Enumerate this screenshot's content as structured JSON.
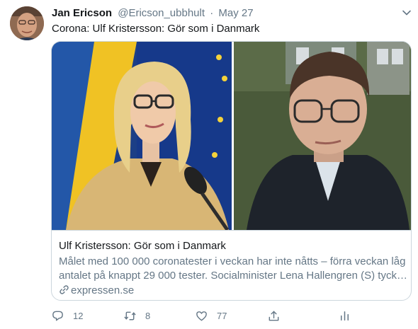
{
  "tweet": {
    "author_name": "Jan Ericson",
    "handle": "@Ericson_ubbhult",
    "separator": "·",
    "date": "May 27",
    "text": "Corona: Ulf Kristersson: Gör som i Danmark"
  },
  "card": {
    "title": "Ulf Kristersson: Gör som i Danmark",
    "description_line1": "Målet med 100 000 coronatester i veckan har inte nåtts – förra veckan låg",
    "description_line2": "antalet på knappt 29 000 tester. Socialminister Lena Hallengren (S) tyck…",
    "domain": "expressen.se"
  },
  "actions": {
    "reply_count": "12",
    "retweet_count": "8",
    "like_count": "77"
  },
  "icons": {
    "reply": "reply-icon",
    "retweet": "retweet-icon",
    "like": "heart-icon",
    "share": "share-icon",
    "analytics": "analytics-icon",
    "caret": "chevron-down-icon",
    "link": "link-icon"
  },
  "colors": {
    "text": "#14171a",
    "secondary": "#657786",
    "border": "#ccd6dd",
    "flag_blue": "#1f5ba8",
    "flag_yellow": "#f2c623"
  }
}
